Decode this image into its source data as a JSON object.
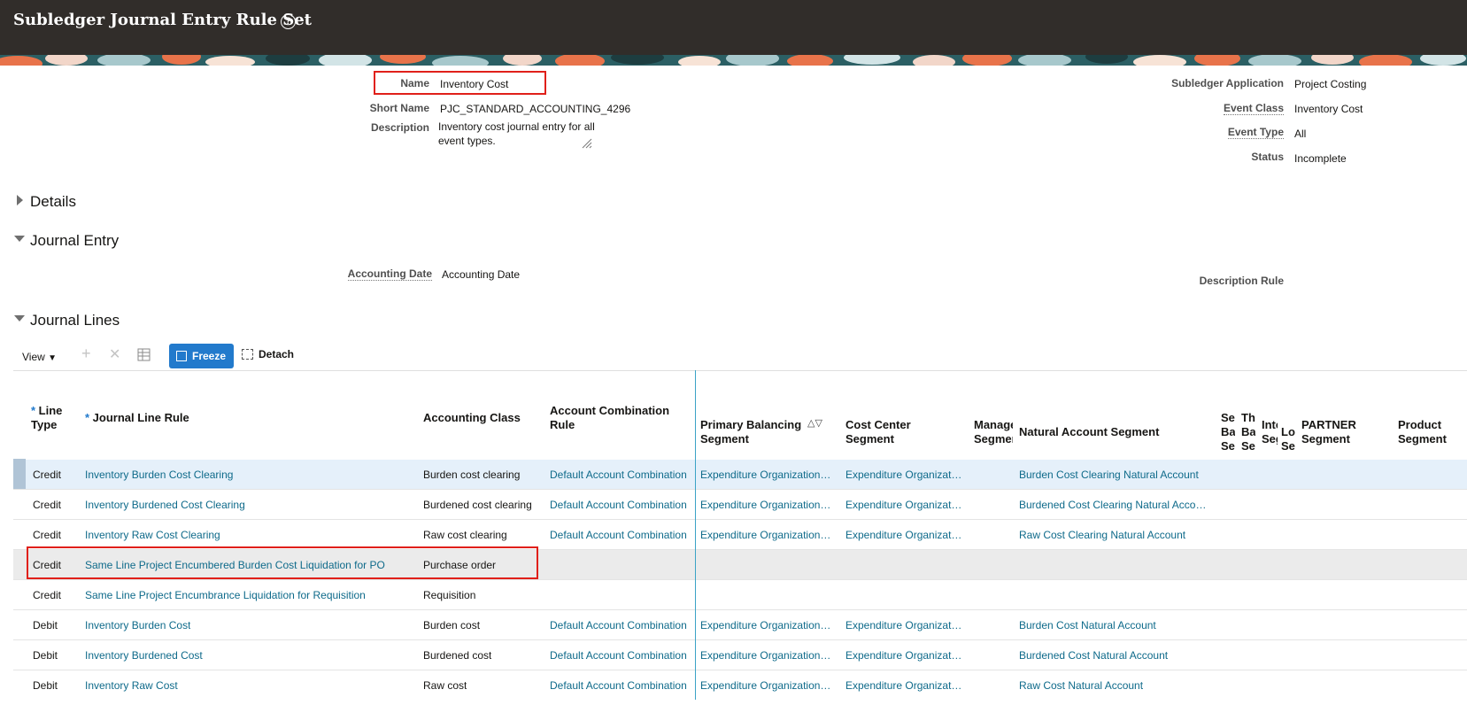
{
  "header": {
    "title": "Subledger Journal Entry Rule Set",
    "help": "?"
  },
  "fields": {
    "name_label": "Name",
    "name_value": "Inventory Cost",
    "short_name_label": "Short Name",
    "short_name_value": "PJC_STANDARD_ACCOUNTING_4296",
    "description_label": "Description",
    "description_value": "Inventory cost journal entry for all event types.",
    "subledger_app_label": "Subledger Application",
    "subledger_app_value": "Project Costing",
    "event_class_label": "Event Class",
    "event_class_value": "Inventory Cost",
    "event_type_label": "Event Type",
    "event_type_value": "All",
    "status_label": "Status",
    "status_value": "Incomplete"
  },
  "sections": {
    "details": "Details",
    "journal_entry": "Journal Entry",
    "journal_lines": "Journal Lines"
  },
  "journal_entry": {
    "accounting_date_label": "Accounting Date",
    "accounting_date_value": "Accounting Date",
    "description_rule_label": "Description Rule"
  },
  "toolbar": {
    "view": "View",
    "freeze": "Freeze",
    "detach": "Detach"
  },
  "table": {
    "headers": {
      "line_type": "Line Type",
      "journal_line_rule": "Journal Line Rule",
      "accounting_class": "Accounting Class",
      "account_combination_rule": "Account Combination Rule",
      "primary_balancing": "Primary Balancing Segment",
      "cost_center": "Cost Center Segment",
      "management": "Management Segment",
      "natural_account": "Natural Account Segment",
      "second_balancing": "Second Balancing Segment",
      "third_balancing": "Third Balancing Segment",
      "intercompany": "Intercompany Segment",
      "location": "Location Segment",
      "partner": "PARTNER Segment",
      "product": "Product Segment"
    },
    "rows": [
      {
        "line_type": "Credit",
        "rule": "Inventory Burden Cost Clearing",
        "acct_class": "Burden cost clearing",
        "combo": "Default Account Combination",
        "primary": "Expenditure Organization …",
        "cost_center": "Expenditure Organizat…",
        "natural": "Burden Cost Clearing Natural Account"
      },
      {
        "line_type": "Credit",
        "rule": "Inventory Burdened Cost Clearing",
        "acct_class": "Burdened cost clearing",
        "combo": "Default Account Combination",
        "primary": "Expenditure Organization …",
        "cost_center": "Expenditure Organizat…",
        "natural": "Burdened Cost Clearing Natural Acco…"
      },
      {
        "line_type": "Credit",
        "rule": "Inventory Raw Cost Clearing",
        "acct_class": "Raw cost clearing",
        "combo": "Default Account Combination",
        "primary": "Expenditure Organization …",
        "cost_center": "Expenditure Organizat…",
        "natural": "Raw Cost Clearing Natural Account"
      },
      {
        "line_type": "Credit",
        "rule": "Same Line Project Encumbered Burden Cost Liquidation for PO",
        "acct_class": "Purchase order",
        "combo": "",
        "primary": "",
        "cost_center": "",
        "natural": ""
      },
      {
        "line_type": "Credit",
        "rule": "Same Line Project Encumbrance Liquidation for Requisition",
        "acct_class": "Requisition",
        "combo": "",
        "primary": "",
        "cost_center": "",
        "natural": ""
      },
      {
        "line_type": "Debit",
        "rule": "Inventory Burden Cost",
        "acct_class": "Burden cost",
        "combo": "Default Account Combination",
        "primary": "Expenditure Organization …",
        "cost_center": "Expenditure Organizat…",
        "natural": "Burden Cost Natural Account"
      },
      {
        "line_type": "Debit",
        "rule": "Inventory Burdened Cost",
        "acct_class": "Burdened cost",
        "combo": "Default Account Combination",
        "primary": "Expenditure Organization …",
        "cost_center": "Expenditure Organizat…",
        "natural": "Burdened Cost Natural Account"
      },
      {
        "line_type": "Debit",
        "rule": "Inventory Raw Cost",
        "acct_class": "Raw cost",
        "combo": "Default Account Combination",
        "primary": "Expenditure Organization …",
        "cost_center": "Expenditure Organizat…",
        "natural": "Raw Cost Natural Account"
      }
    ]
  },
  "colors": {
    "header_bg": "#312d2a",
    "link": "#0e6a8a",
    "freeze_bg": "#227acc",
    "highlight_border": "#e0201a"
  }
}
